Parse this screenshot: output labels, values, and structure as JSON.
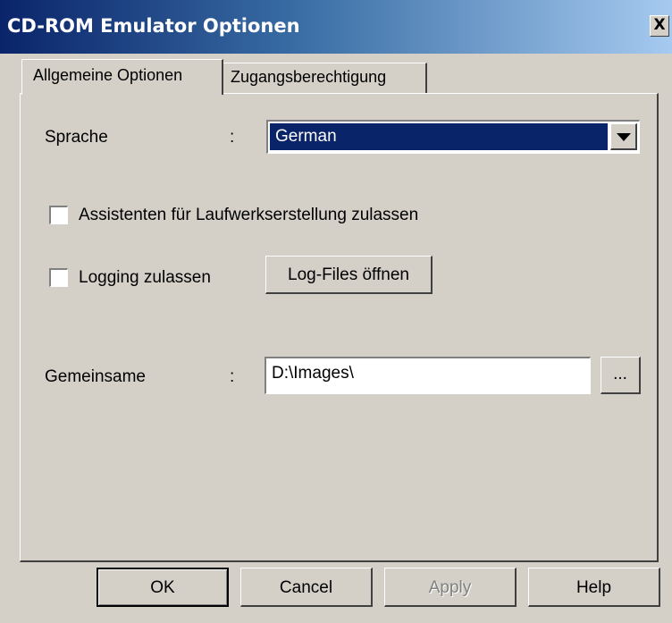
{
  "window": {
    "title": "CD-ROM Emulator Optionen",
    "close_label": "X"
  },
  "tabs": [
    {
      "label": "Allgemeine Optionen",
      "active": true
    },
    {
      "label": "Zugangsberechtigung",
      "active": false
    }
  ],
  "language": {
    "label": "Sprache",
    "separator": ":",
    "selected": "German"
  },
  "wizard_option": {
    "label": "Assistenten für Laufwerkserstellung zulassen",
    "checked": false
  },
  "logging_option": {
    "label": "Logging zulassen",
    "checked": false,
    "open_logs_label": "Log-Files öffnen"
  },
  "shared_folder": {
    "label": "Gemeinsame",
    "separator": ":",
    "value": "D:\\Images\\",
    "browse_label": "..."
  },
  "footer": {
    "ok_label": "OK",
    "cancel_label": "Cancel",
    "apply_label": "Apply",
    "help_label": "Help"
  }
}
